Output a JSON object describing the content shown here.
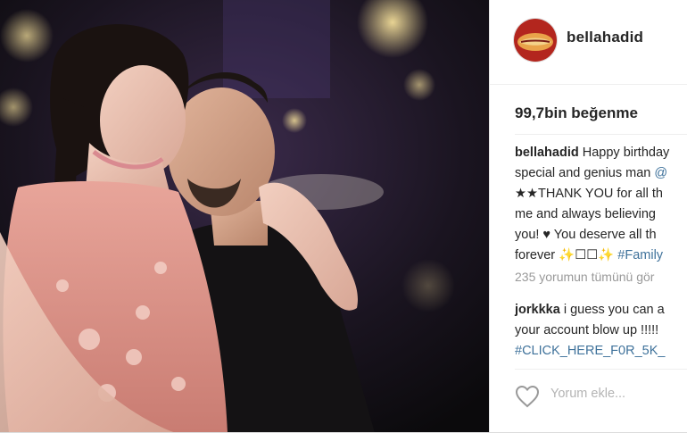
{
  "post": {
    "username": "bellahadid",
    "likes": "99,7bin beğenme",
    "caption": {
      "username": "bellahadid",
      "line1": " Happy birthday",
      "line2_text": "special and genius man ",
      "line2_link": "@",
      "line3": "★★THANK YOU for all th",
      "line4": "me and always believing",
      "line5": "you! ♥ You deserve all th",
      "line6_text": "forever ✨☐☐✨ ",
      "line6_link": "#Family"
    },
    "more_comments": "235 yorumun tümünü gör",
    "comment": {
      "username": "jorkkka",
      "line1": " i guess you can a",
      "line2": "your account blow up !!!!!",
      "line3_link": "#CLICK_HERE_F0R_5K_"
    },
    "add_comment_placeholder": "Yorum ekle..."
  },
  "colors": {
    "link": "#3f729b",
    "muted": "#999999",
    "text": "#262626"
  }
}
